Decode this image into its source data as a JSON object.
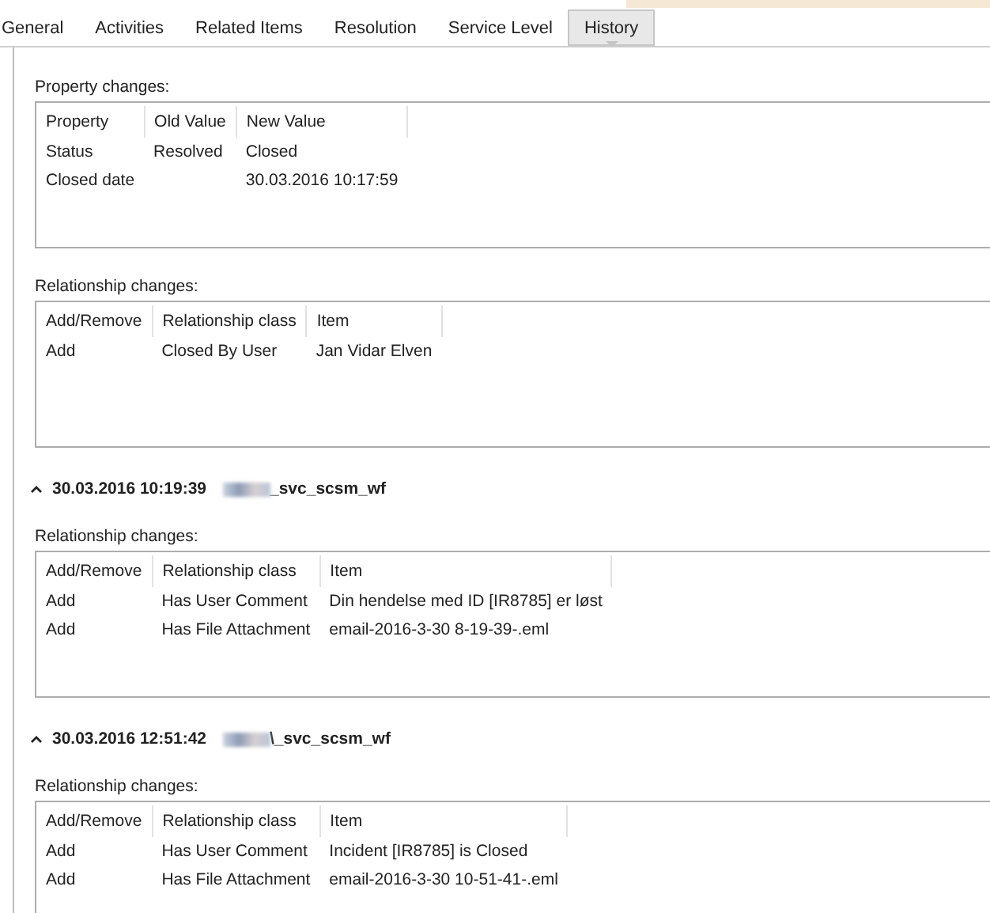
{
  "tabs": [
    {
      "label": "General",
      "selected": false
    },
    {
      "label": "Activities",
      "selected": false
    },
    {
      "label": "Related Items",
      "selected": false
    },
    {
      "label": "Resolution",
      "selected": false
    },
    {
      "label": "Service Level",
      "selected": false
    },
    {
      "label": "History",
      "selected": true
    }
  ],
  "entries": [
    {
      "tables": [
        {
          "label": "Property changes:",
          "columns": [
            "Property",
            "Old Value",
            "New Value"
          ],
          "rows": [
            [
              "Status",
              "Resolved",
              "Closed"
            ],
            [
              "Closed date",
              "",
              "30.03.2016 10:17:59"
            ]
          ]
        },
        {
          "label": "Relationship changes:",
          "columns": [
            "Add/Remove",
            "Relationship class",
            "Item"
          ],
          "rows": [
            [
              "Add",
              "Closed By User",
              "Jan Vidar Elven"
            ]
          ]
        }
      ]
    },
    {
      "header": {
        "expanded": true,
        "time": "30.03.2016 10:19:39",
        "user": "_svc_scsm_wf"
      },
      "tables": [
        {
          "label": "Relationship changes:",
          "columns": [
            "Add/Remove",
            "Relationship class",
            "Item"
          ],
          "rows": [
            [
              "Add",
              "Has User Comment",
              "Din hendelse med ID [IR8785] er løst"
            ],
            [
              "Add",
              "Has File Attachment",
              "email-2016-3-30 8-19-39-.eml"
            ]
          ]
        }
      ]
    },
    {
      "header": {
        "expanded": true,
        "time": "30.03.2016 12:51:42",
        "user": "\\_svc_scsm_wf"
      },
      "tables": [
        {
          "label": "Relationship changes:",
          "columns": [
            "Add/Remove",
            "Relationship class",
            "Item"
          ],
          "rows": [
            [
              "Add",
              "Has User Comment",
              "Incident [IR8785] is Closed"
            ],
            [
              "Add",
              "Has File Attachment",
              "email-2016-3-30 10-51-41-.eml"
            ]
          ]
        }
      ]
    }
  ]
}
